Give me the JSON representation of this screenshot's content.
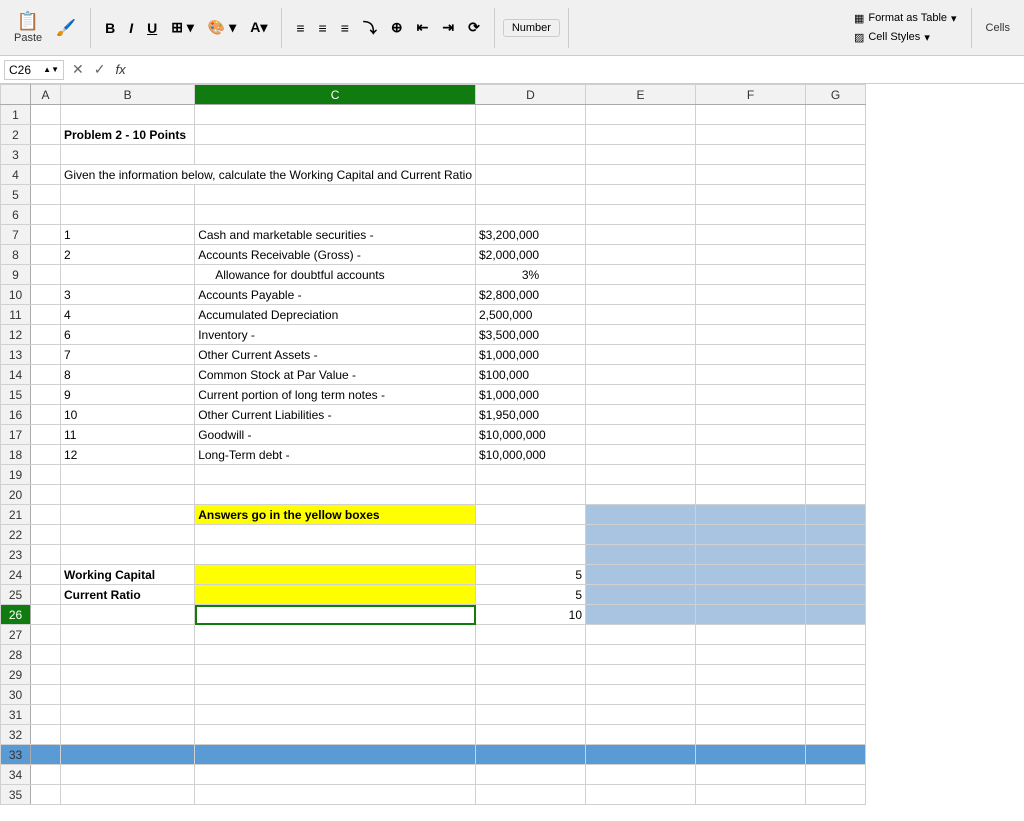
{
  "toolbar": {
    "paste_label": "Paste",
    "bold_label": "B",
    "italic_label": "I",
    "underline_label": "U",
    "number_label": "Number",
    "format_as_table_label": "Format as Table",
    "cell_styles_label": "Cell Styles",
    "cells_label": "Cells"
  },
  "formula_bar": {
    "cell_ref": "C26",
    "fx_label": "fx"
  },
  "columns": [
    "A",
    "B",
    "C",
    "D",
    "E",
    "F",
    "G"
  ],
  "rows": {
    "1": {},
    "2": {
      "b": "Problem 2  -  10 Points"
    },
    "3": {},
    "4": {
      "b": "Given the information below, calculate the Working Capital and Current Ratio"
    },
    "5": {},
    "6": {},
    "7": {
      "b": "1",
      "c": "Cash and marketable securities -",
      "d": "$3,200,000"
    },
    "8": {
      "b": "2",
      "c": "Accounts Receivable (Gross) -",
      "d": "$2,000,000"
    },
    "9": {
      "c": "Allowance for doubtful accounts",
      "d": "3%"
    },
    "10": {
      "b": "3",
      "c": "Accounts Payable -",
      "d": "$2,800,000"
    },
    "11": {
      "b": "4",
      "c": "Accumulated Depreciation",
      "d": "2,500,000"
    },
    "12": {
      "b": "6",
      "c": "Inventory -",
      "d": "$3,500,000"
    },
    "13": {
      "b": "7",
      "c": "Other Current Assets -",
      "d": "$1,000,000"
    },
    "14": {
      "b": "8",
      "c": "Common Stock at Par Value -",
      "d": "$100,000"
    },
    "15": {
      "b": "9",
      "c": "Current portion of long term notes -",
      "d": "$1,000,000"
    },
    "16": {
      "b": "10",
      "c": "Other Current Liabilities -",
      "d": "$1,950,000"
    },
    "17": {
      "b": "11",
      "c": "Goodwill -",
      "d": "$10,000,000"
    },
    "18": {
      "b": "12",
      "c": "Long-Term debt -",
      "d": "$10,000,000"
    },
    "19": {},
    "20": {},
    "21": {
      "c": "Answers go in the yellow boxes",
      "c_style": "yellow"
    },
    "22": {},
    "23": {},
    "24": {
      "b": "Working Capital",
      "c_style": "yellow",
      "d": "5"
    },
    "25": {
      "b": "Current Ratio",
      "c_style": "yellow",
      "d": "5"
    },
    "26": {
      "c_style": "active",
      "d": "10"
    },
    "27": {},
    "28": {},
    "29": {},
    "30": {},
    "31": {},
    "32": {},
    "33": {
      "row_style": "blue-row"
    },
    "34": {},
    "35": {}
  }
}
